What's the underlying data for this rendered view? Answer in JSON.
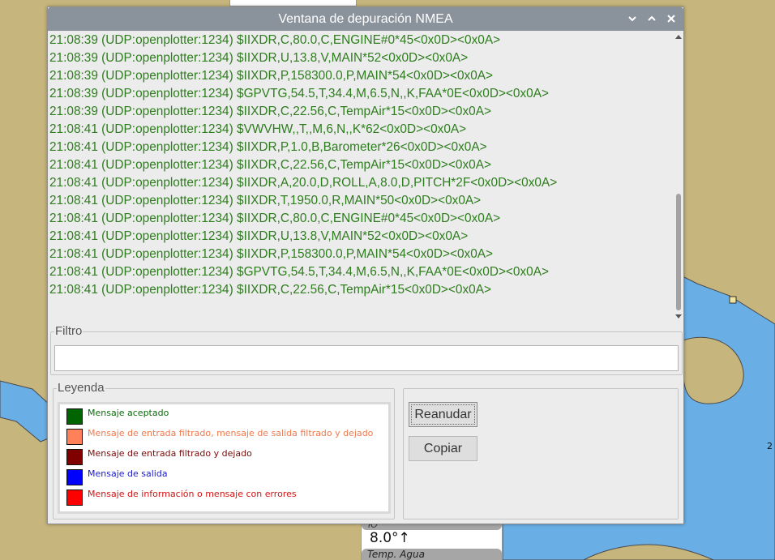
{
  "window": {
    "title": "Ventana de depuración NMEA",
    "controls": {
      "minimize_icon": "chevron-down-icon",
      "maximize_icon": "chevron-up-icon",
      "close_icon": "close-icon"
    }
  },
  "log": {
    "lines": [
      "21:08:39 (UDP:openplotter:1234) $IIXDR,C,80.0,C,ENGINE#0*45<0x0D><0x0A>",
      "21:08:39 (UDP:openplotter:1234) $IIXDR,U,13.8,V,MAIN*52<0x0D><0x0A>",
      "21:08:39 (UDP:openplotter:1234) $IIXDR,P,158300.0,P,MAIN*54<0x0D><0x0A>",
      "21:08:39 (UDP:openplotter:1234) $GPVTG,54.5,T,34.4,M,6.5,N,,K,FAA*0E<0x0D><0x0A>",
      "21:08:39 (UDP:openplotter:1234) $IIXDR,C,22.56,C,TempAir*15<0x0D><0x0A>",
      "21:08:41 (UDP:openplotter:1234) $VWVHW,,T,,M,6,N,,K*62<0x0D><0x0A>",
      "21:08:41 (UDP:openplotter:1234) $IIXDR,P,1.0,B,Barometer*26<0x0D><0x0A>",
      "21:08:41 (UDP:openplotter:1234) $IIXDR,C,22.56,C,TempAir*15<0x0D><0x0A>",
      "21:08:41 (UDP:openplotter:1234) $IIXDR,A,20.0,D,ROLL,A,8.0,D,PITCH*2F<0x0D><0x0A>",
      "21:08:41 (UDP:openplotter:1234) $IIXDR,T,1950.0,R,MAIN*50<0x0D><0x0A>",
      "21:08:41 (UDP:openplotter:1234) $IIXDR,C,80.0,C,ENGINE#0*45<0x0D><0x0A>",
      "21:08:41 (UDP:openplotter:1234) $IIXDR,U,13.8,V,MAIN*52<0x0D><0x0A>",
      "21:08:41 (UDP:openplotter:1234) $IIXDR,P,158300.0,P,MAIN*54<0x0D><0x0A>",
      "21:08:41 (UDP:openplotter:1234) $GPVTG,54.5,T,34.4,M,6.5,N,,K,FAA*0E<0x0D><0x0A>",
      "21:08:41 (UDP:openplotter:1234) $IIXDR,C,22.56,C,TempAir*15<0x0D><0x0A>"
    ],
    "text_color": "#2e7d1e"
  },
  "filter": {
    "label": "Filtro",
    "value": "",
    "placeholder": ""
  },
  "legend": {
    "label": "Leyenda",
    "items": [
      {
        "text": "Mensaje aceptado",
        "color": "#006400",
        "text_color": "#0a6b0a"
      },
      {
        "text": "Mensaje de entrada filtrado, mensaje de salida filtrado y dejado",
        "color": "#ff8059",
        "text_color": "#f07a4e"
      },
      {
        "text": "Mensaje de entrada filtrado y dejado",
        "color": "#800000",
        "text_color": "#7a0a0a"
      },
      {
        "text": "Mensaje de salida",
        "color": "#0000ff",
        "text_color": "#1a1acc"
      },
      {
        "text": "Mensaje de información o mensaje con errores",
        "color": "#ff0000",
        "text_color": "#d11212"
      }
    ]
  },
  "buttons": {
    "resume": "Reanudar",
    "copy": "Copiar"
  },
  "map": {
    "instrument": {
      "label_top": "Ю",
      "value": "8.0°↑",
      "label_bottom": "Temp. Agua"
    },
    "edge_number": "2",
    "colors": {
      "land": "#c6b57c",
      "water": "#6aaee6"
    }
  }
}
